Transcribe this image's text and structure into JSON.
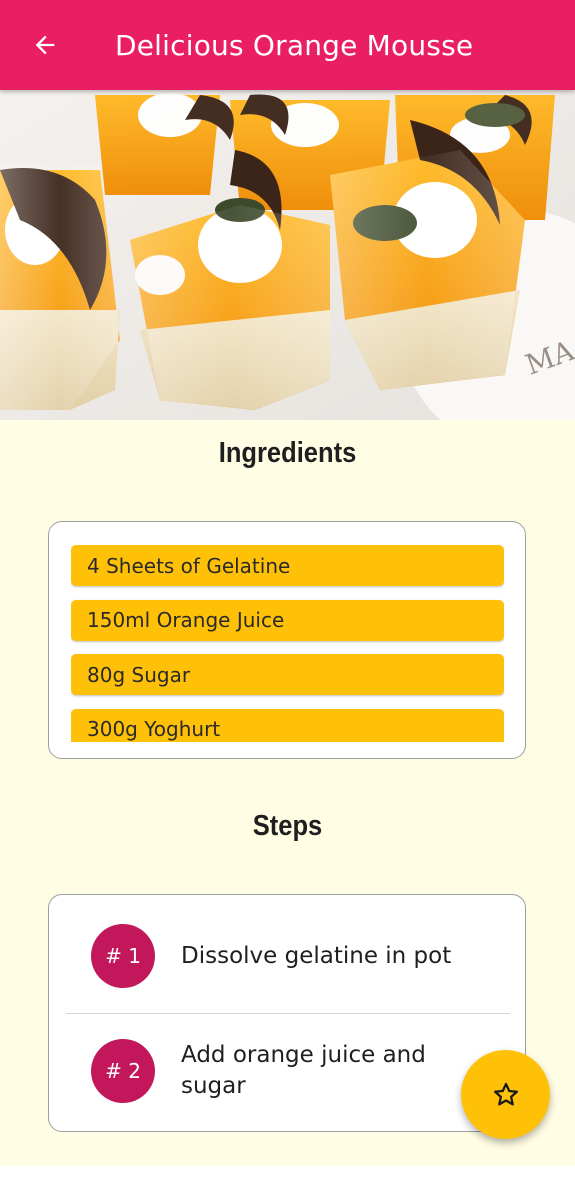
{
  "app_bar": {
    "title": "Delicious Orange Mousse",
    "back_icon": "arrow-back-icon",
    "color": "#e91e63"
  },
  "hero_image": {
    "description_icon": "orange-mousse-photo"
  },
  "ingredients": {
    "title": "Ingredients",
    "items": [
      "4 Sheets of Gelatine",
      "150ml Orange Juice",
      "80g Sugar",
      "300g Yoghurt"
    ],
    "item_color": "#ffc107"
  },
  "steps": {
    "title": "Steps",
    "items": [
      {
        "number": "# 1",
        "text": "Dissolve gelatine in pot"
      },
      {
        "number": "# 2",
        "text": "Add orange juice and sugar"
      }
    ],
    "badge_color": "#c2185b"
  },
  "fab": {
    "icon": "star-outline-icon",
    "color": "#ffc107"
  },
  "background_color": "#fffde4"
}
